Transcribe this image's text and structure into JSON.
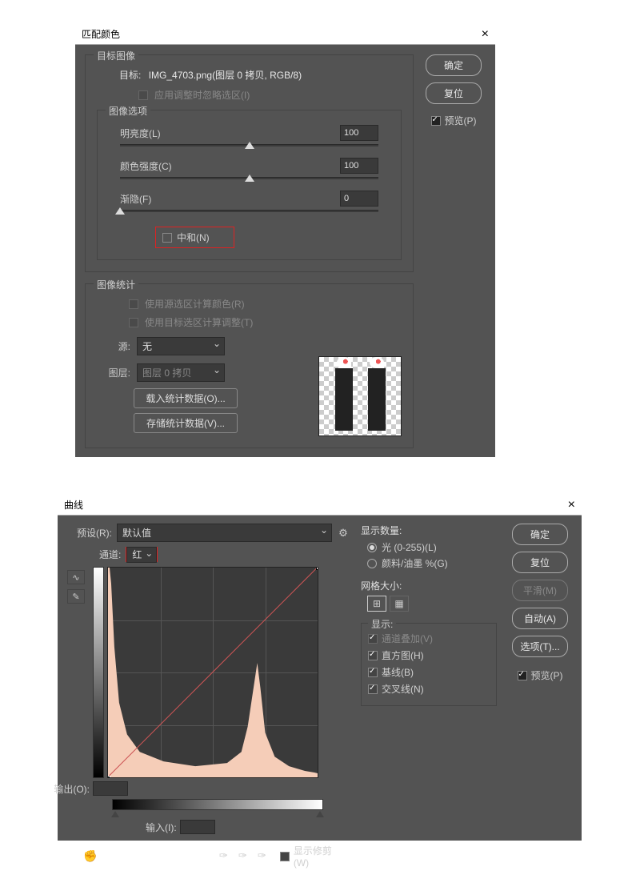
{
  "dialog1": {
    "title": "匹配颜色",
    "target_section": {
      "legend": "目标图像",
      "target_label": "目标:",
      "target_value": "IMG_4703.png(图层 0 拷贝, RGB/8)",
      "ignore_cb": "应用调整时忽略选区(I)"
    },
    "options": {
      "legend": "图像选项",
      "luminance": {
        "label": "明亮度(L)",
        "value": "100",
        "pos": 50
      },
      "intensity": {
        "label": "颜色强度(C)",
        "value": "100",
        "pos": 50
      },
      "fade": {
        "label": "渐隐(F)",
        "value": "0",
        "pos": 0
      },
      "neutralize": "中和(N)"
    },
    "stats": {
      "legend": "图像统计",
      "use_source": "使用源选区计算颜色(R)",
      "use_target": "使用目标选区计算调整(T)",
      "source_label": "源:",
      "source_value": "无",
      "layer_label": "图层:",
      "layer_value": "图层 0 拷贝",
      "load_btn": "载入统计数据(O)...",
      "save_btn": "存储统计数据(V)..."
    },
    "buttons": {
      "ok": "确定",
      "reset": "复位",
      "preview": "预览(P)"
    }
  },
  "dialog2": {
    "title": "曲线",
    "preset_label": "预设(R):",
    "preset_value": "默认值",
    "channel_label": "通道:",
    "channel_value": "红",
    "output_label": "输出(O):",
    "input_label": "输入(I):",
    "show_clipping": "显示修剪 (W)",
    "amount": {
      "title": "显示数量:",
      "light": "光 (0-255)(L)",
      "pigment": "颜料/油墨 %(G)"
    },
    "gridsize_label": "网格大小:",
    "display": {
      "legend": "显示:",
      "overlay": "通道叠加(V)",
      "hist": "直方图(H)",
      "baseline": "基线(B)",
      "intersect": "交叉线(N)"
    },
    "buttons": {
      "ok": "确定",
      "reset": "复位",
      "smooth": "平滑(M)",
      "auto": "自动(A)",
      "options": "选项(T)...",
      "preview": "预览(P)"
    }
  }
}
